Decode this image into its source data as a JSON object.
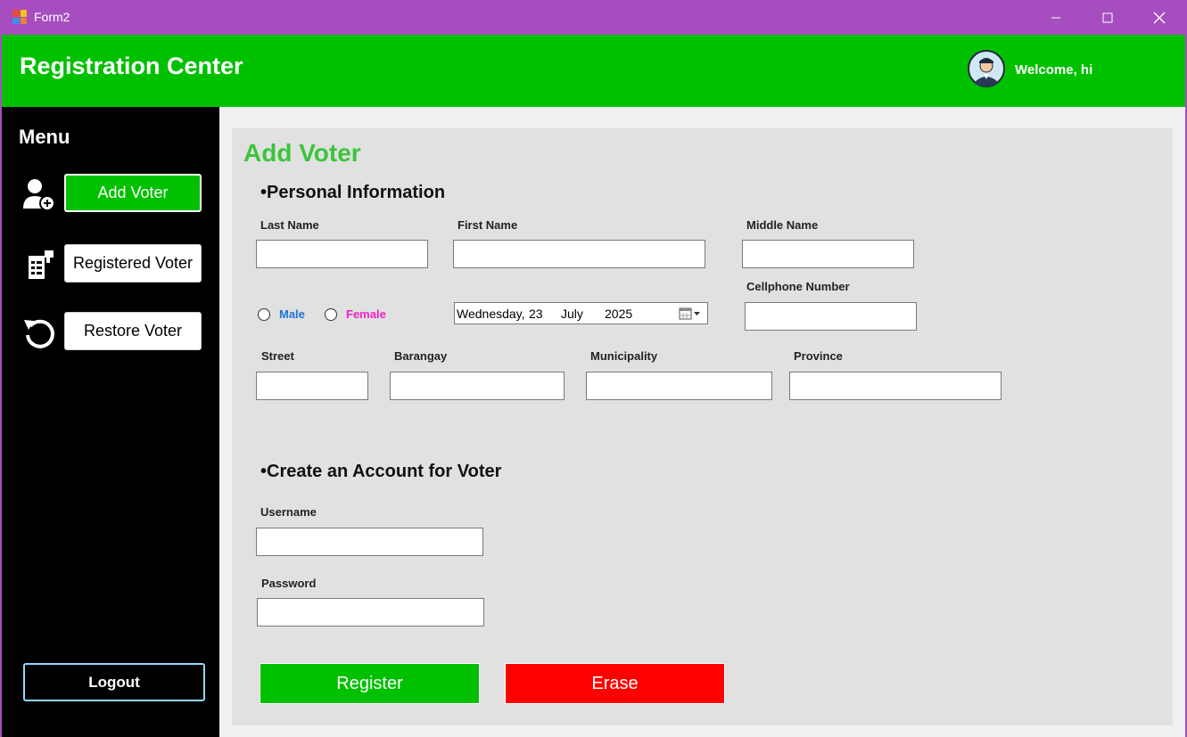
{
  "window": {
    "title": "Form2",
    "controls": [
      "minimize",
      "maximize",
      "close"
    ]
  },
  "header": {
    "title": "Registration Center",
    "welcome": "Welcome, hi",
    "color": "#00c000"
  },
  "sidebar": {
    "menu_title": "Menu",
    "items": [
      {
        "label": "Add Voter",
        "icon": "add-user-icon",
        "active": true
      },
      {
        "label": "Registered Voter",
        "icon": "document-list-icon",
        "active": false
      },
      {
        "label": "Restore Voter",
        "icon": "restore-icon",
        "active": false
      }
    ],
    "logout": "Logout"
  },
  "form": {
    "title": "Add Voter",
    "personal_section": "•Personal Information",
    "fields": {
      "last_name": {
        "label": "Last Name",
        "value": ""
      },
      "first_name": {
        "label": "First Name",
        "value": ""
      },
      "middle_name": {
        "label": "Middle Name",
        "value": ""
      },
      "cellphone": {
        "label": "Cellphone Number",
        "value": ""
      },
      "street": {
        "label": "Street",
        "value": ""
      },
      "barangay": {
        "label": "Barangay",
        "value": ""
      },
      "municipality": {
        "label": "Municipality",
        "value": ""
      },
      "province": {
        "label": "Province",
        "value": ""
      }
    },
    "gender": {
      "male": "Male",
      "female": "Female",
      "male_color": "#1e73d8",
      "female_color": "#f020c8"
    },
    "birthdate": {
      "weekday": "Wednesday,",
      "day": "23",
      "month": "July",
      "year": "2025"
    },
    "account_section": "•Create an Account for Voter",
    "username": {
      "label": "Username",
      "value": ""
    },
    "password": {
      "label": "Password",
      "value": ""
    },
    "register": "Register",
    "erase": "Erase",
    "register_color": "#00c000",
    "erase_color": "#ff0000"
  }
}
